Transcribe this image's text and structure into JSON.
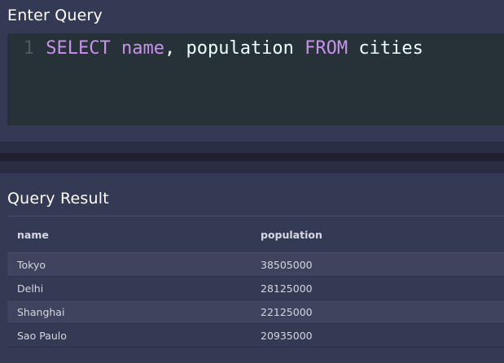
{
  "query_panel": {
    "title": "Enter Query",
    "line_number": "1",
    "tokens": {
      "kw_select": "SELECT",
      "col_name": "name",
      "comma": ",",
      "col_population": "population",
      "kw_from": "FROM",
      "table": "cities"
    }
  },
  "result_panel": {
    "title": "Query Result",
    "columns": [
      "name",
      "population"
    ],
    "rows": [
      [
        "Tokyo",
        "38505000"
      ],
      [
        "Delhi",
        "28125000"
      ],
      [
        "Shanghai",
        "22125000"
      ],
      [
        "Sao Paulo",
        "20935000"
      ]
    ]
  },
  "colors": {
    "background": "#353a54",
    "editor_bg": "#263238",
    "keyword": "#c792ea",
    "identifier": "#eeffff"
  }
}
